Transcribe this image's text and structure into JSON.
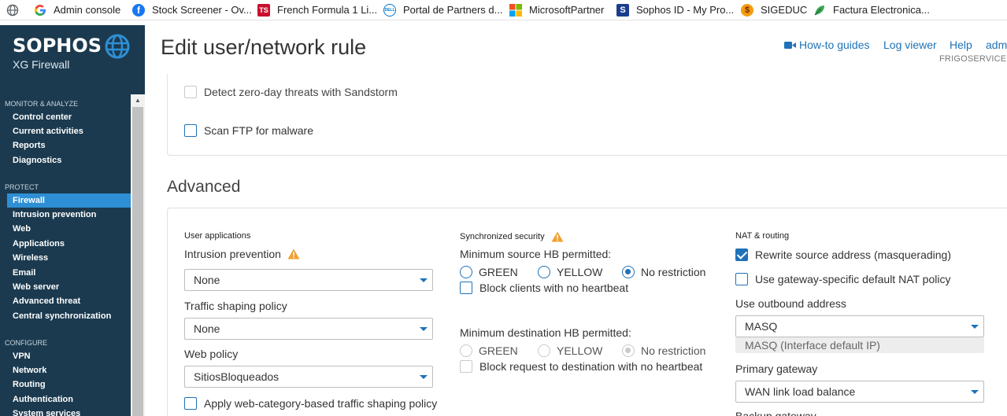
{
  "bookmarks": [
    {
      "label": "",
      "icon": "globe-icon"
    },
    {
      "label": "Admin console",
      "icon": "google-icon"
    },
    {
      "label": "Stock Screener - Ov...",
      "icon": "facebook-icon"
    },
    {
      "label": "French Formula 1 Li...",
      "icon": "ts-icon"
    },
    {
      "label": "Portal de Partners d...",
      "icon": "dell-icon"
    },
    {
      "label": "MicrosoftPartner",
      "icon": "microsoft-icon"
    },
    {
      "label": "Sophos ID - My Pro...",
      "icon": "sophos-icon"
    },
    {
      "label": "SIGEDUC",
      "icon": "dollar-icon"
    },
    {
      "label": "Factura Electronica...",
      "icon": "leaf-icon"
    }
  ],
  "sidebar": {
    "brand": "SOPHOS",
    "product": "XG Firewall",
    "sections": [
      {
        "title": "MONITOR & ANALYZE",
        "items": [
          "Control center",
          "Current activities",
          "Reports",
          "Diagnostics"
        ]
      },
      {
        "title": "PROTECT",
        "items": [
          "Firewall",
          "Intrusion prevention",
          "Web",
          "Applications",
          "Wireless",
          "Email",
          "Web server",
          "Advanced threat",
          "Central synchronization"
        ]
      },
      {
        "title": "CONFIGURE",
        "items": [
          "VPN",
          "Network",
          "Routing",
          "Authentication",
          "System services"
        ]
      }
    ],
    "active_item": "Firewall"
  },
  "header": {
    "title": "Edit user/network rule",
    "howto": "How-to guides",
    "logviewer": "Log viewer",
    "help": "Help",
    "admin": "adm",
    "org": "FRIGOSERVICE"
  },
  "top_card": {
    "sandstorm": "Detect zero-day threats with Sandstorm",
    "ftp": "Scan FTP for malware"
  },
  "advanced": {
    "title": "Advanced",
    "user_apps": {
      "heading": "User applications",
      "ips_label": "Intrusion prevention",
      "ips_value": "None",
      "shaping_label": "Traffic shaping policy",
      "shaping_value": "None",
      "web_label": "Web policy",
      "web_value": "SitiosBloqueados",
      "web_cat": "Apply web-category-based traffic shaping policy"
    },
    "sync": {
      "heading": "Synchronized security",
      "src_label": "Minimum source HB permitted:",
      "green": "GREEN",
      "yellow": "YELLOW",
      "norestrict": "No restriction",
      "block_clients": "Block clients with no heartbeat",
      "dst_label": "Minimum destination HB permitted:",
      "block_dst": "Block request to destination with no heartbeat"
    },
    "nat": {
      "heading": "NAT & routing",
      "rewrite": "Rewrite source address (masquerading)",
      "gateway_nat": "Use gateway-specific default NAT policy",
      "outbound_label": "Use outbound address",
      "outbound_value": "MASQ",
      "outbound_hint": "MASQ (Interface default IP)",
      "primary_label": "Primary gateway",
      "primary_value": "WAN link load balance",
      "backup_label": "Backup gateway"
    }
  },
  "colors": {
    "sidebar": "#1b3a4f",
    "accent": "#1f72b8",
    "active": "#2e8fd4",
    "warning": "#f0a030"
  }
}
